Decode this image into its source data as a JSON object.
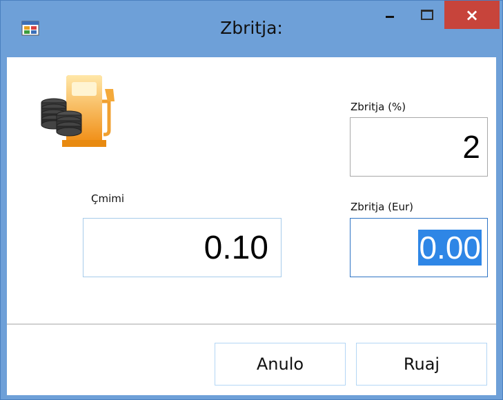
{
  "window": {
    "title": "Zbritja:",
    "icon": "app-window-icon",
    "controls": {
      "minimize": "minimize-icon",
      "maximize": "maximize-icon",
      "close": "×"
    }
  },
  "form": {
    "icon": "fuel-pump-coins-icon",
    "discount_percent": {
      "label": "Zbritja (%)",
      "value": "2"
    },
    "discount_eur": {
      "label": "Zbritja (Eur)",
      "value": "0.00",
      "selected": true
    },
    "price": {
      "label": "Çmimi",
      "value": "0.10"
    }
  },
  "buttons": {
    "cancel_label": "Anulo",
    "save_label": "Ruaj"
  },
  "colors": {
    "titlebar": "#6ea0d8",
    "close_button": "#c7443b",
    "selection": "#2e86e6",
    "focus_border": "#2d73c4"
  }
}
